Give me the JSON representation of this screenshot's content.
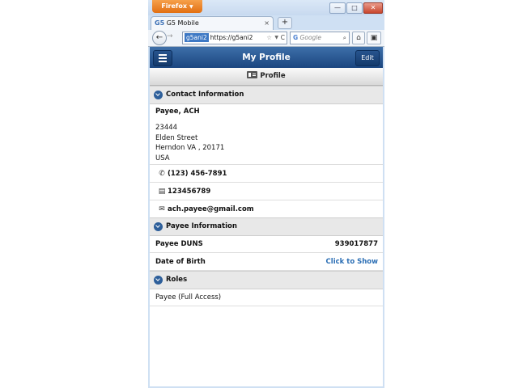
{
  "browser": {
    "menu_label": "Firefox",
    "tab_title": "G5 Mobile",
    "tab_favicon": "G5",
    "new_tab": "+",
    "url_site": "g5ani2",
    "url_text": "https://g5ani2",
    "search_engine": "G",
    "search_placeholder": "Google",
    "window_buttons": [
      "—",
      "□",
      "✕"
    ]
  },
  "app": {
    "title": "My Profile",
    "edit_label": "Edit",
    "profile_tab": "Profile"
  },
  "contact": {
    "header": "Contact Information",
    "name": "Payee, ACH",
    "address_lines": [
      "23444",
      "Elden Street",
      "Herndon VA , 20171",
      "USA"
    ],
    "phone": "(123) 456-7891",
    "fax": "123456789",
    "email": "ach.payee@gmail.com"
  },
  "payee": {
    "header": "Payee Information",
    "duns_label": "Payee DUNS",
    "duns_value": "939017877",
    "dob_label": "Date of Birth",
    "dob_value": "Click to Show"
  },
  "roles": {
    "header": "Roles",
    "items": [
      "Payee (Full Access)"
    ]
  },
  "colors": {
    "header_blue": "#1b4680",
    "link_blue": "#2c6fb5",
    "firefox_orange": "#e26f12"
  }
}
